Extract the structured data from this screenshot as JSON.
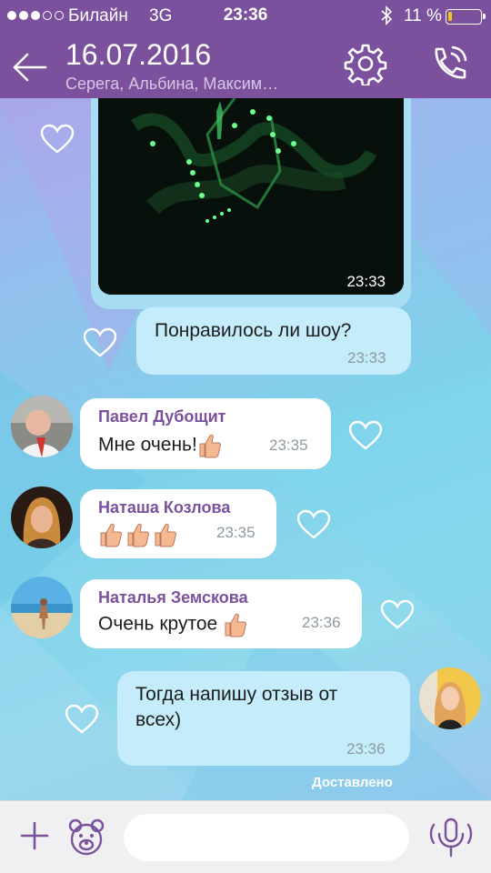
{
  "status_bar": {
    "carrier": "Билайн",
    "network": "3G",
    "time": "23:36",
    "battery_percent": "11 %",
    "battery_level": 0.11
  },
  "header": {
    "title": "16.07.2016",
    "subtitle": "Серега, Альбина, Максим…",
    "icons": [
      "back-arrow-icon",
      "gear-icon",
      "phone-call-icon"
    ]
  },
  "messages": [
    {
      "type": "media",
      "time": "23:33"
    },
    {
      "type": "outgoing",
      "text": "Понравилось ли шоу?",
      "time": "23:33"
    },
    {
      "type": "incoming",
      "sender": "Павел  Дубощит",
      "text": "Мне очень!",
      "time": "23:35"
    },
    {
      "type": "incoming",
      "sender": "Наташа Козлова",
      "text": "",
      "time": "23:35"
    },
    {
      "type": "incoming",
      "sender": "Наталья Земскова",
      "text": "Очень крутое",
      "time": "23:36"
    },
    {
      "type": "outgoing",
      "text_line1": "Тогда напишу отзыв от",
      "text_line2": "всех)",
      "time": "23:36"
    }
  ],
  "delivered_label": "Доставлено",
  "composer": {
    "placeholder": "",
    "icons": [
      "plus-icon",
      "sticker-bear-icon",
      "microphone-icon"
    ]
  },
  "colors": {
    "brand": "#7b519d",
    "sender_name": "#7b519d",
    "outgoing_bubble": "#c5ecfa",
    "incoming_bubble": "#ffffff"
  }
}
